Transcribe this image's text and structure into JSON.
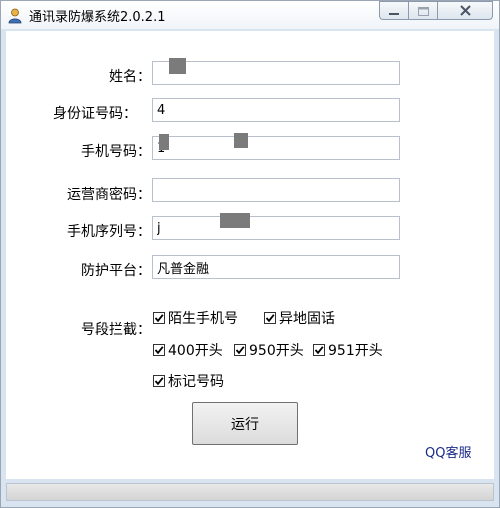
{
  "window": {
    "title": "通讯录防爆系统2.0.2.1",
    "icon": "person-icon",
    "controls": [
      "minimize-icon",
      "maximize-icon",
      "close-icon"
    ]
  },
  "form": {
    "name_label": "姓名：",
    "name_value": "",
    "id_label": "身份证号码：",
    "id_value": "4",
    "phone_label": "手机号码：",
    "phone_value": "1",
    "carrier_pwd_label": "运营商密码：",
    "carrier_pwd_value": "",
    "serial_label": "手机序列号：",
    "serial_value": "j",
    "platform_label": "防护平台：",
    "platform_value": "凡普金融"
  },
  "blocking": {
    "label": "号段拦截：",
    "options": [
      {
        "label": "陌生手机号",
        "checked": true
      },
      {
        "label": "异地固话",
        "checked": true
      },
      {
        "label": "400开头",
        "checked": true
      },
      {
        "label": "950开头",
        "checked": true
      },
      {
        "label": "951开头",
        "checked": true
      },
      {
        "label": "标记号码",
        "checked": true
      }
    ]
  },
  "actions": {
    "run_label": "运行",
    "qq_service_label": "QQ客服"
  }
}
